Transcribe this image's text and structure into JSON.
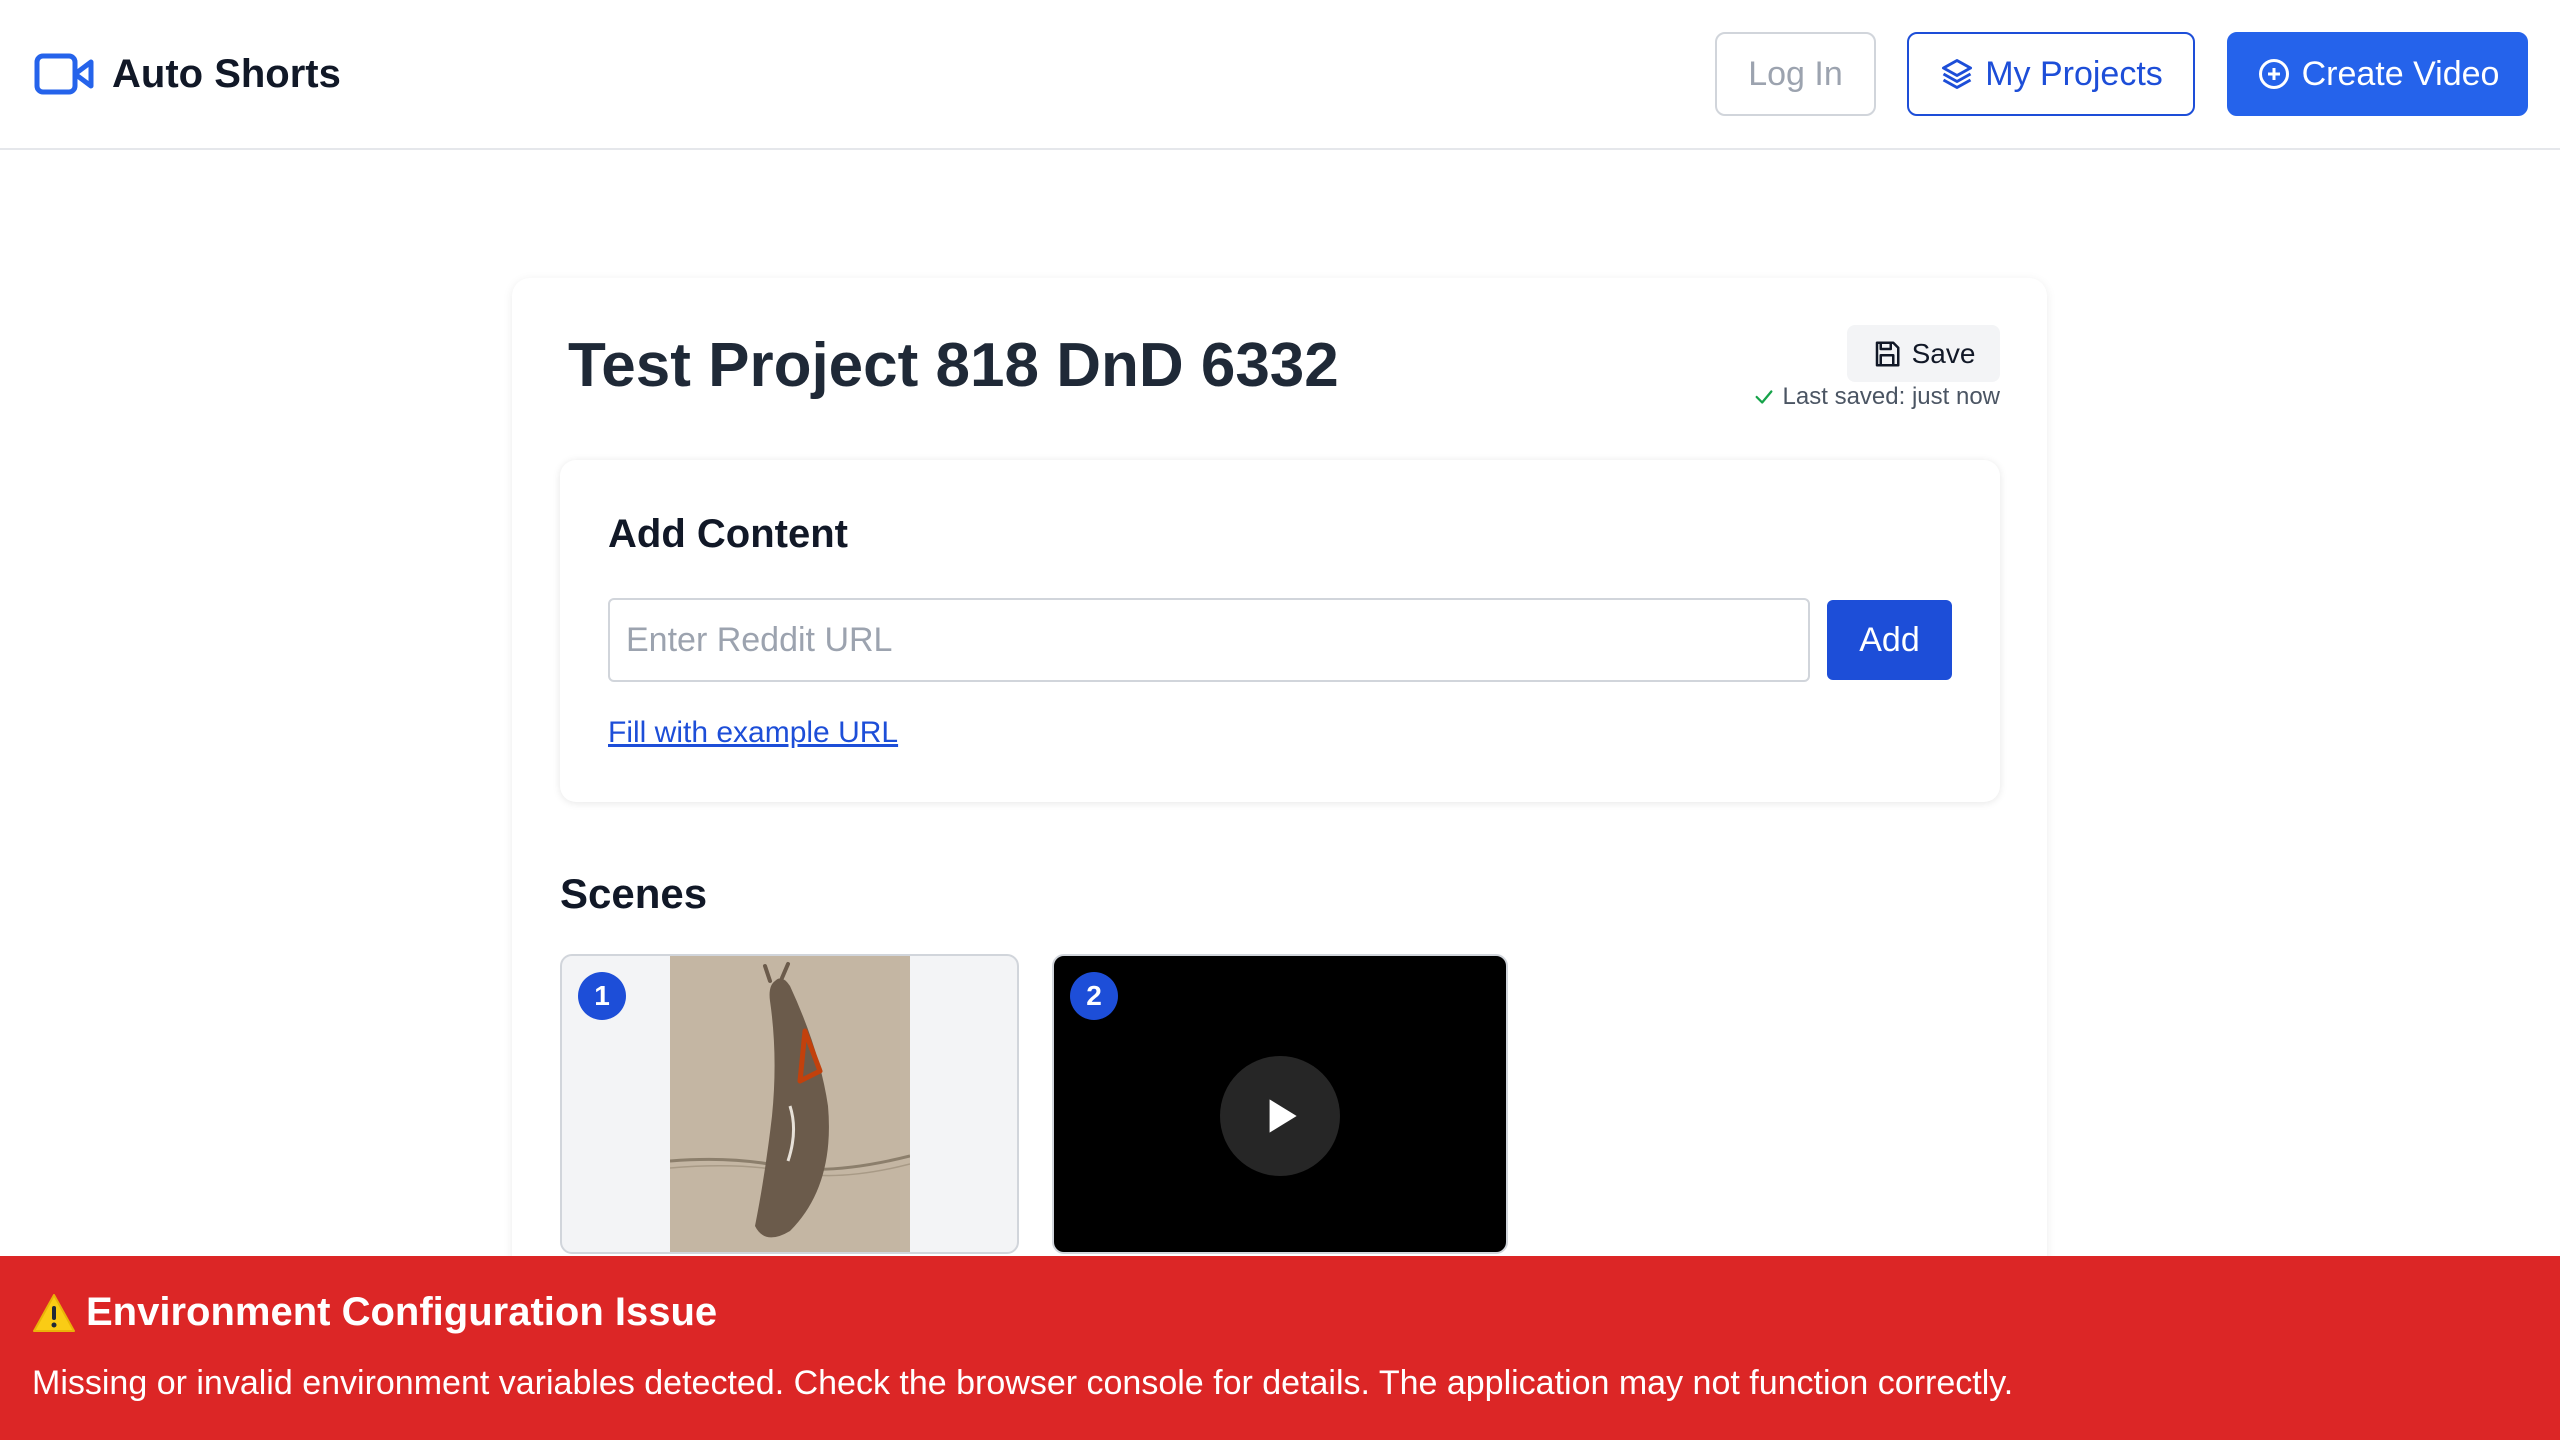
{
  "header": {
    "brand": "Auto Shorts",
    "login_label": "Log In",
    "projects_label": "My Projects",
    "create_label": "Create Video"
  },
  "project": {
    "title": "Test Project 818 DnD 6332",
    "save_label": "Save",
    "saved_status": "Last saved: just now"
  },
  "add_content": {
    "title": "Add Content",
    "input_placeholder": "Enter Reddit URL",
    "input_value": "",
    "add_label": "Add",
    "example_link": "Fill with example URL"
  },
  "scenes": {
    "title": "Scenes",
    "items": [
      {
        "number": "1",
        "type": "image"
      },
      {
        "number": "2",
        "type": "video"
      }
    ]
  },
  "error": {
    "icon": "warning-icon",
    "title": "Environment Configuration Issue",
    "message": "Missing or invalid environment variables detected. Check the browser console for details. The application may not function correctly."
  },
  "colors": {
    "primary": "#2563eb",
    "primary_dark": "#1d4ed8",
    "error": "#dc2626",
    "success": "#16a34a"
  }
}
